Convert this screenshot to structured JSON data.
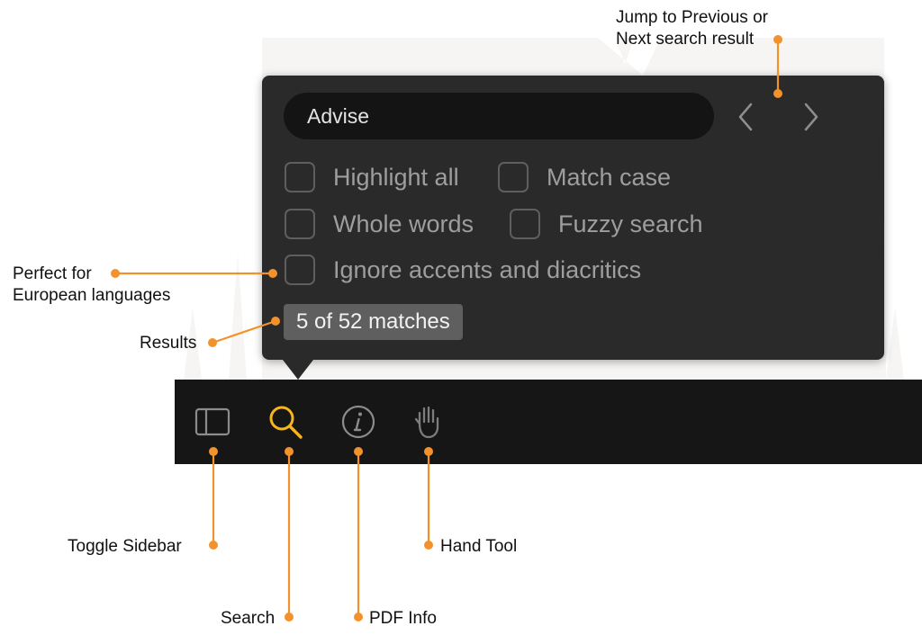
{
  "search": {
    "value": "Advise",
    "prev_icon": "chevron-left-icon",
    "next_icon": "chevron-right-icon"
  },
  "options": {
    "highlight_all": "Highlight all",
    "match_case": "Match case",
    "whole_words": "Whole words",
    "fuzzy_search": "Fuzzy search",
    "ignore_accents": "Ignore accents and diacritics"
  },
  "results": {
    "text": "5 of 52 matches"
  },
  "toolbar": {
    "items": [
      {
        "icon": "sidebar-icon",
        "active": false
      },
      {
        "icon": "search-icon",
        "active": true
      },
      {
        "icon": "info-icon",
        "active": false
      },
      {
        "icon": "hand-icon",
        "active": false
      }
    ]
  },
  "annotations": {
    "nav": "Jump to Previous or\nNext search result",
    "accents": "Perfect for\nEuropean languages",
    "results": "Results",
    "sidebar": "Toggle Sidebar",
    "search": "Search",
    "pdf_info": "PDF Info",
    "hand_tool": "Hand Tool"
  },
  "colors": {
    "accent": "#f3922b",
    "search_active": "#f4b51e",
    "popover_bg": "#2a2a2a",
    "toolbar_bg": "#161616"
  }
}
